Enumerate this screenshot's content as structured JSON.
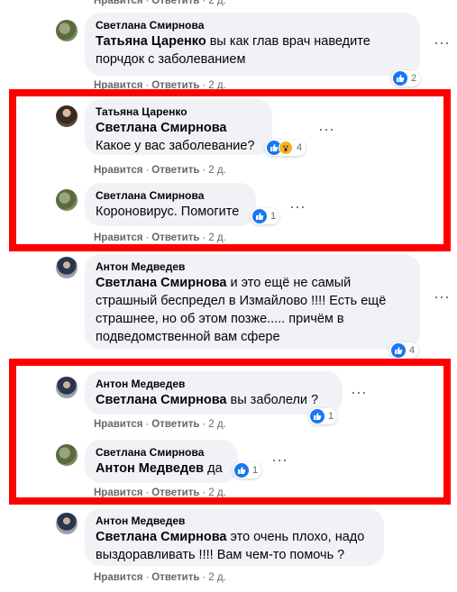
{
  "actions": {
    "like": "Нравится",
    "reply": "Ответить",
    "separator": "·"
  },
  "comments": [
    {
      "author": "Светлана Смирнова",
      "mention": "Татьяна Царенко",
      "line1": " вы как глав врач наведите",
      "line2": "порчдок с заболеванием",
      "time": "2 д.",
      "reactions": "2"
    },
    {
      "author": "Татьяна Царенко",
      "mention": "Светлана Смирнова",
      "line1": "Какое у вас заболевание?",
      "time": "2 д.",
      "reactions": "4"
    },
    {
      "author": "Светлана Смирнова",
      "line1": "Короновирус. Помогите",
      "time": "2 д.",
      "reactions": "1"
    },
    {
      "author": "Антон Медведев",
      "mention": "Светлана Смирнова",
      "line1": " и это ещё не самый",
      "line2": "страшный беспредел в Измайлово !!!! Есть ещё",
      "line3": "страшнее, но об этом позже..... причём в",
      "line4": "подведомственной вам сфере",
      "reactions": "4"
    },
    {
      "author": "Антон Медведев",
      "mention": "Светлана Смирнова",
      "line1": " вы заболели ?",
      "time": "2 д.",
      "reactions": "1"
    },
    {
      "author": "Светлана Смирнова",
      "mention": "Антон Медведев",
      "line1": " да",
      "time": "2 д.",
      "reactions": "1"
    },
    {
      "author": "Антон Медведев",
      "mention": "Светлана Смирнова",
      "line1": " это очень плохо, надо",
      "line2": "выздоравливать !!!! Вам чем-то помочь ?",
      "time": "2 д."
    }
  ],
  "colors": {
    "highlight": "#ff0000",
    "like_blue": "#1877f2",
    "bubble": "#f0f2f5",
    "meta": "#65676b"
  },
  "icons": {
    "more": "more-dots-icon",
    "like": "like-icon",
    "wow": "wow-icon"
  }
}
